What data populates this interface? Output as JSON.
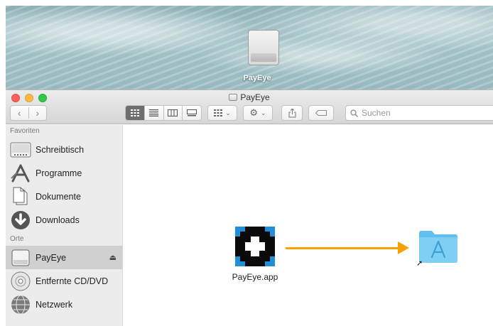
{
  "desktop": {
    "drive_label": "PayEye"
  },
  "window": {
    "title": "PayEye",
    "search": {
      "placeholder": "Suchen",
      "value": ""
    }
  },
  "sidebar": {
    "sections": [
      {
        "heading": "Favoriten"
      },
      {
        "heading": "Orte"
      }
    ],
    "favorites": [
      {
        "label": "Schreibtisch",
        "icon": "desktop-icon"
      },
      {
        "label": "Programme",
        "icon": "applications-icon"
      },
      {
        "label": "Dokumente",
        "icon": "documents-icon"
      },
      {
        "label": "Downloads",
        "icon": "downloads-icon"
      }
    ],
    "places": [
      {
        "label": "PayEye",
        "icon": "drive-icon",
        "selected": true
      },
      {
        "label": "Entfernte CD/DVD",
        "icon": "disc-icon"
      },
      {
        "label": "Netzwerk",
        "icon": "network-icon"
      }
    ]
  },
  "content": {
    "items": [
      {
        "label": "PayEye.app",
        "icon": "payeye-app-icon"
      },
      {
        "label": "",
        "icon": "applications-folder-alias-icon"
      }
    ],
    "arrow_color": "#f5a100"
  },
  "colors": {
    "accent": "#f5a100",
    "folder": "#5ec0ee"
  }
}
